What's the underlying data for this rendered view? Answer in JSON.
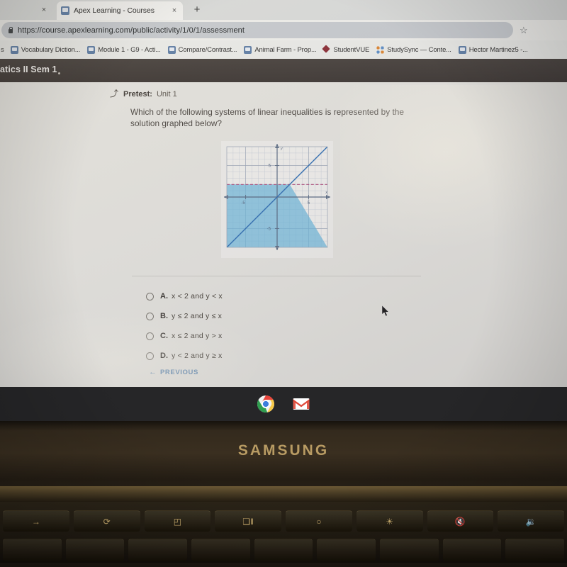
{
  "browser": {
    "tab": {
      "title": "Apex Learning - Courses",
      "favicon_name": "apex-favicon",
      "close_label": "×"
    },
    "left_tab_close_label": "×",
    "new_tab_label": "+",
    "omnibox": {
      "url": "https://course.apexlearning.com/public/activity/1/0/1/assessment",
      "lock_icon": "lock-icon",
      "star_icon": "☆"
    },
    "bookmarks": {
      "truncated_left_label": "s",
      "items": [
        {
          "label": "Vocabulary Diction...",
          "icon": "doc-icon"
        },
        {
          "label": "Module 1 - G9 - Acti...",
          "icon": "doc-icon"
        },
        {
          "label": "Compare/Contrast...",
          "icon": "doc-icon"
        },
        {
          "label": "Animal Farm - Prop...",
          "icon": "doc-icon"
        },
        {
          "label": "StudentVUE",
          "icon": "diamond-icon"
        },
        {
          "label": "StudySync — Conte...",
          "icon": "dots-icon"
        },
        {
          "label": "Hector Martinez5 -...",
          "icon": "doc-icon"
        }
      ]
    }
  },
  "apex": {
    "course_title": "atics II Sem 1",
    "breadcrumb": {
      "up_icon": "⤴",
      "bold": "Pretest:",
      "normal": "Unit 1"
    },
    "question": "Which of the following systems of linear inequalities is represented by the solution graphed below?",
    "choices": [
      {
        "letter": "A.",
        "text": "x < 2  and  y < x"
      },
      {
        "letter": "B.",
        "text": "y ≤ 2  and  y ≤ x"
      },
      {
        "letter": "C.",
        "text": "x ≤ 2  and  y > x"
      },
      {
        "letter": "D.",
        "text": "y < 2  and  y ≥ x"
      }
    ],
    "previous_button": {
      "arrow": "←",
      "label": "PREVIOUS"
    }
  },
  "chart_data": {
    "type": "line",
    "title": "",
    "xlabel": "x",
    "ylabel": "y",
    "xlim": [
      -8,
      8
    ],
    "ylim": [
      -8,
      8
    ],
    "grid": true,
    "xticks": [
      -5,
      5
    ],
    "yticks": [
      -5,
      5
    ],
    "xtick_labels": [
      "-5",
      "5"
    ],
    "ytick_labels": [
      "-5",
      "5"
    ],
    "axis_color": "#5a6b84",
    "grid_color": "#b8c0cd",
    "series": [
      {
        "name": "y = x",
        "kind": "solid-boundary",
        "slope": 1,
        "intercept": 0,
        "color": "#2f6fb5",
        "dashed": false
      },
      {
        "name": "y = 2",
        "kind": "dashed-boundary",
        "slope": 0,
        "intercept": 2,
        "color": "#b0487a",
        "dashed": true
      }
    ],
    "shaded_region": {
      "description": "y < 2 and y < x",
      "fill_color": "#6db8dd",
      "opacity": 0.75
    }
  },
  "shelf": {
    "icons": [
      {
        "name": "chrome-icon"
      },
      {
        "name": "gmail-icon"
      }
    ]
  },
  "laptop": {
    "brand": "SAMSUNG",
    "fn_keys": [
      "→",
      "⟳",
      "◰",
      "❑‖",
      "○",
      "☀",
      "🔇",
      "🔉"
    ]
  }
}
